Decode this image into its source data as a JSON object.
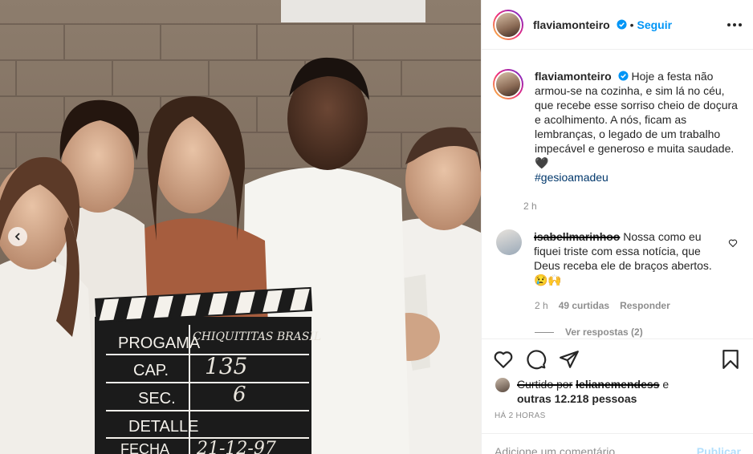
{
  "post": {
    "username": "flaviamonteiro",
    "follow_separator": "•",
    "follow_label": "Seguir",
    "caption": "Hoje a festa não armou-se na cozinha, e sim lá no céu, que recebe esse sorriso cheio de doçura e acolhimento. A nós, ficam as lembranças, o legado de um trabalho impecável e generoso e muita saudade. 🖤",
    "hashtag": "#gesioamadeu",
    "caption_time": "2 h"
  },
  "clapperboard": {
    "row1_label": "PROGAMA",
    "row1_value": "CHIQUITITAS BRASIL",
    "row2_label": "CAP.",
    "row2_value": "135",
    "row3_label": "SEC.",
    "row3_value": "6",
    "row4_label": "DETALLE",
    "row5_label": "FECHA",
    "row5_value": "21-12-97"
  },
  "comment": {
    "username": "isabellmarinhoo",
    "text": "Nossa como eu fiquei triste com essa notícia, que Deus receba ele de braços abertos. 😢🙌",
    "time": "2 h",
    "likes": "49 curtidas",
    "reply_label": "Responder",
    "view_replies": "Ver respostas (2)"
  },
  "likes": {
    "prefix": "Curtido por",
    "user": "lelianemendess",
    "joiner": "e",
    "others": "outras 12.218 pessoas"
  },
  "timestamp": "HÁ 2 HORAS",
  "add_comment": {
    "placeholder": "Adicione um comentário...",
    "publish_label": "Publicar"
  },
  "colors": {
    "accent": "#0095f6",
    "hashtag": "#00376b",
    "muted": "#8e8e8e",
    "publish_disabled": "#b2dffc"
  },
  "icons": {
    "verified": "verified-badge-icon",
    "more": "more-options-icon",
    "heart": "heart-icon",
    "comment": "comment-icon",
    "share": "share-icon",
    "save": "bookmark-icon",
    "carousel_prev": "chevron-left-icon"
  }
}
